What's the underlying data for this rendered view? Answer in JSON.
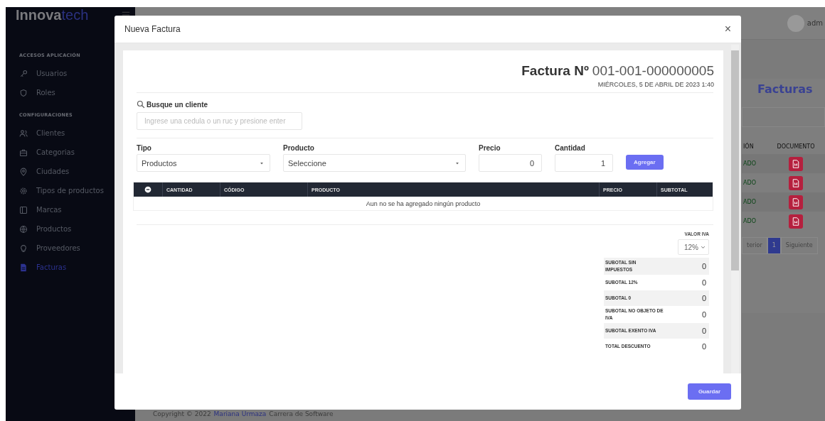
{
  "sidebar": {
    "logo": {
      "primary": "Innova",
      "accent": "tech"
    },
    "sections": [
      {
        "heading": "ACCESOS APLICACIÓN",
        "items": [
          {
            "label": "Usuarios",
            "selected": false
          },
          {
            "label": "Roles",
            "selected": false
          }
        ]
      },
      {
        "heading": "CONFIGURACIONES",
        "items": [
          {
            "label": "Clientes",
            "selected": false
          },
          {
            "label": "Categorias",
            "selected": false
          },
          {
            "label": "Ciudades",
            "selected": false
          },
          {
            "label": "Tipos de productos",
            "selected": false
          },
          {
            "label": "Marcas",
            "selected": false
          },
          {
            "label": "Productos",
            "selected": false
          },
          {
            "label": "Proveedores",
            "selected": false
          },
          {
            "label": "Facturas",
            "selected": true
          }
        ]
      }
    ]
  },
  "background_page": {
    "user_label": "adm",
    "title": "Facturas",
    "columns": [
      "IÓN",
      "DOCUMENTO"
    ],
    "rows": [
      {
        "status": "ADO"
      },
      {
        "status": "ADO"
      },
      {
        "status": "ADO"
      },
      {
        "status": "ADO"
      }
    ],
    "pagination": {
      "previous": "terior",
      "pages": [
        {
          "label": "1",
          "selected": true
        }
      ],
      "next": "Siguiente"
    },
    "footer": {
      "prefix": "Copyright © 2022",
      "author": "Mariana Urmaza",
      "suffix": "Carrera de Software"
    }
  },
  "modal": {
    "title": "Nueva Factura",
    "close": "×",
    "invoice": {
      "label": "Factura Nº",
      "number": "001-001-000000005",
      "date": "MIÉRCOLES, 5 DE ABRIL DE 2023 1:40"
    },
    "client_search": {
      "label": "Busque un cliente",
      "placeholder": "Ingrese una cedula o un ruc y presione enter"
    },
    "fields": [
      {
        "kind": "select",
        "label": "Tipo",
        "value": "Productos"
      },
      {
        "kind": "select",
        "label": "Producto",
        "value": "Seleccione"
      },
      {
        "kind": "number",
        "label": "Precio",
        "value": "0"
      },
      {
        "kind": "number",
        "label": "Cantidad",
        "value": "1"
      }
    ],
    "add_button": "Agregar",
    "table": {
      "columns": [
        "CANTIDAD",
        "CÓDIGO",
        "PRODUCTO",
        "PRECIO",
        "SUBTOTAL"
      ],
      "empty_message": "Aun no se ha agregado ningún producto"
    },
    "iva": {
      "label": "VALOR IVA",
      "value": "12%"
    },
    "totals": [
      {
        "label": "SUBOTAL SIN IMPUESTOS",
        "value": "0"
      },
      {
        "label": "SUBOTAL 12%",
        "value": "0"
      },
      {
        "label": "SUBOTAL 0",
        "value": "0"
      },
      {
        "label": "SUBOTAL NO OBJETO DE IVA",
        "value": "0"
      },
      {
        "label": "SUBOTAL EXENTO IVA",
        "value": "0"
      },
      {
        "label": "TOTAL DESCUENTO",
        "value": "0"
      }
    ],
    "save_button": "Guardar"
  }
}
